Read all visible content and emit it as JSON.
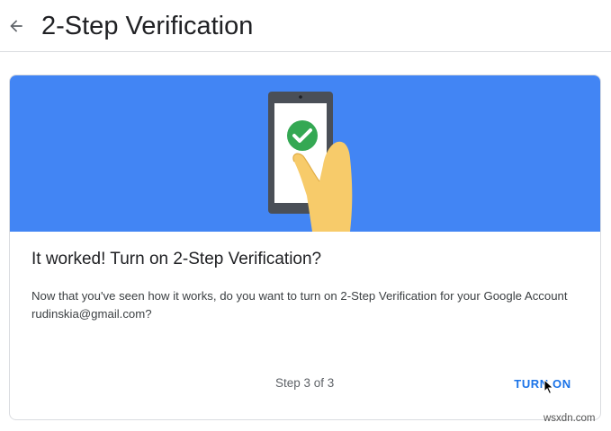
{
  "header": {
    "title": "2-Step Verification"
  },
  "card": {
    "heading": "It worked! Turn on 2-Step Verification?",
    "body": "Now that you've seen how it works, do you want to turn on 2-Step Verification for your Google Account rudinskia@gmail.com?",
    "step_text": "Step 3 of 3",
    "turn_on_label": "TURN ON"
  },
  "icons": {
    "back": "arrow-back-icon",
    "phone": "phone-check-illustration",
    "check": "check-circle-icon"
  },
  "colors": {
    "hero_background": "#4285f4",
    "accent": "#1a73e8",
    "success": "#34a853"
  },
  "watermark": "wsxdn.com"
}
